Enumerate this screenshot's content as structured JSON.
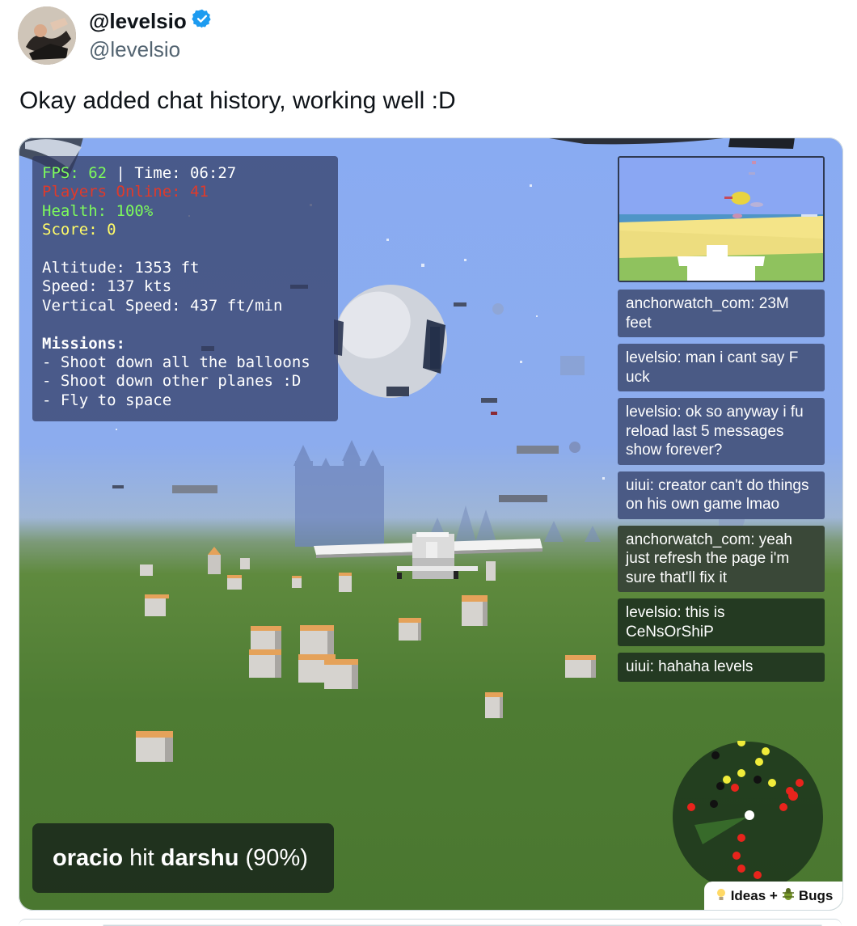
{
  "author": {
    "name": "@levelsio",
    "handle": "@levelsio",
    "verified_icon": "verified-badge-icon",
    "verified_color": "#1d9bf0"
  },
  "tweet": {
    "text": "Okay added chat history, working well :D"
  },
  "hud": {
    "fps_label": "FPS: 62",
    "time_label": " | Time: 06:27",
    "players_online": "Players Online: 41",
    "health": "Health: 100%",
    "score": "Score: 0",
    "altitude": "Altitude: 1353 ft",
    "speed": "Speed: 137 kts",
    "vertical_speed": "Vertical Speed: 437 ft/min",
    "missions_title": "Missions:",
    "missions": [
      "- Shoot down all the balloons",
      "- Shoot down other planes :D",
      "- Fly to space"
    ],
    "colors": {
      "fps": "#7dfa5c",
      "players": "#e03a2a",
      "health": "#7dfa5c",
      "score": "#fffb68"
    }
  },
  "chat": [
    {
      "text": "anchorwatch_com: 23M feet",
      "bg": "#4a5a85"
    },
    {
      "text": "levelsio: man i cant say F uck",
      "bg": "#4a5a85"
    },
    {
      "text": "levelsio: ok so anyway i fu reload last 5 messages show forever?",
      "bg": "#4a5a85"
    },
    {
      "text": "uiui: creator can't do things on his own game lmao",
      "bg": "#4a5a85"
    },
    {
      "text": "anchorwatch_com: yeah just refresh the page i'm sure that'll fix it",
      "bg": "#3a4838"
    },
    {
      "text": "levelsio: this is CeNsOrShiP",
      "bg": "#243a22"
    },
    {
      "text": "uiui: hahaha levels",
      "bg": "#243a22"
    }
  ],
  "hit_banner": {
    "attacker": "oracio",
    "verb": " hit ",
    "target": "darshu",
    "percent": " (90%)"
  },
  "feedback": {
    "ideas_icon": "lightbulb-icon",
    "label_ideas": "Ideas +",
    "bugs_icon": "bug-icon",
    "label_bugs": "Bugs"
  },
  "radar": {
    "icon": "radar-icon"
  }
}
